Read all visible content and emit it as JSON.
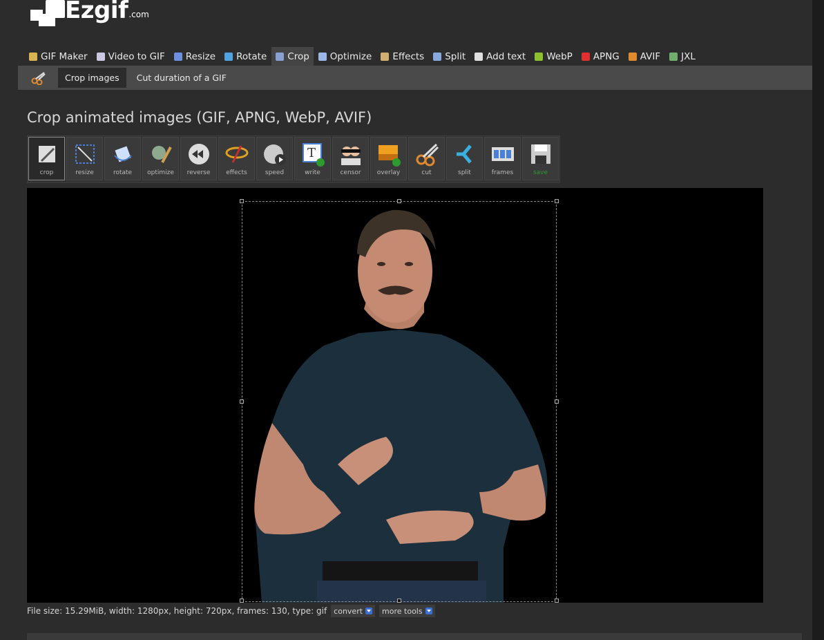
{
  "logo": {
    "text": "Ezgif",
    "suffix": ".com"
  },
  "mainnav": [
    {
      "label": "GIF Maker",
      "icon": "gif-maker-icon",
      "color": "#d9b650"
    },
    {
      "label": "Video to GIF",
      "icon": "video-icon",
      "color": "#c9c9e6"
    },
    {
      "label": "Resize",
      "icon": "resize-icon",
      "color": "#6e8fe0"
    },
    {
      "label": "Rotate",
      "icon": "rotate-icon",
      "color": "#4fa3e0"
    },
    {
      "label": "Crop",
      "icon": "crop-icon",
      "color": "#8aa0d0",
      "active": true
    },
    {
      "label": "Optimize",
      "icon": "optimize-icon",
      "color": "#9bb8e8"
    },
    {
      "label": "Effects",
      "icon": "effects-icon",
      "color": "#d0b070"
    },
    {
      "label": "Split",
      "icon": "split-icon",
      "color": "#8aa8e0"
    },
    {
      "label": "Add text",
      "icon": "add-text-icon",
      "color": "#e0e0e0"
    },
    {
      "label": "WebP",
      "icon": "webp-icon",
      "color": "#8dbf2e"
    },
    {
      "label": "APNG",
      "icon": "apng-icon",
      "color": "#e03030"
    },
    {
      "label": "AVIF",
      "icon": "avif-icon",
      "color": "#e08a30"
    },
    {
      "label": "JXL",
      "icon": "jxl-icon",
      "color": "#6fae6f"
    }
  ],
  "subnav": {
    "active": "Crop images",
    "other": "Cut duration of a GIF"
  },
  "page_title": "Crop animated images (GIF, APNG, WebP, AVIF)",
  "toolbar": [
    {
      "label": "crop",
      "icon": "crop-tool-icon"
    },
    {
      "label": "resize",
      "icon": "resize-tool-icon"
    },
    {
      "label": "rotate",
      "icon": "rotate-tool-icon"
    },
    {
      "label": "optimize",
      "icon": "optimize-tool-icon"
    },
    {
      "label": "reverse",
      "icon": "reverse-tool-icon"
    },
    {
      "label": "effects",
      "icon": "effects-tool-icon"
    },
    {
      "label": "speed",
      "icon": "speed-tool-icon"
    },
    {
      "label": "write",
      "icon": "write-tool-icon"
    },
    {
      "label": "censor",
      "icon": "censor-tool-icon"
    },
    {
      "label": "overlay",
      "icon": "overlay-tool-icon"
    },
    {
      "label": "cut",
      "icon": "cut-tool-icon"
    },
    {
      "label": "split",
      "icon": "split-tool-icon"
    },
    {
      "label": "frames",
      "icon": "frames-tool-icon"
    },
    {
      "label": "save",
      "icon": "save-tool-icon"
    }
  ],
  "fileinfo": {
    "text": "File size: 15.29MiB, width: 1280px, height: 720px, frames: 130, type: gif",
    "convert_label": "convert",
    "more_tools_label": "more tools"
  }
}
